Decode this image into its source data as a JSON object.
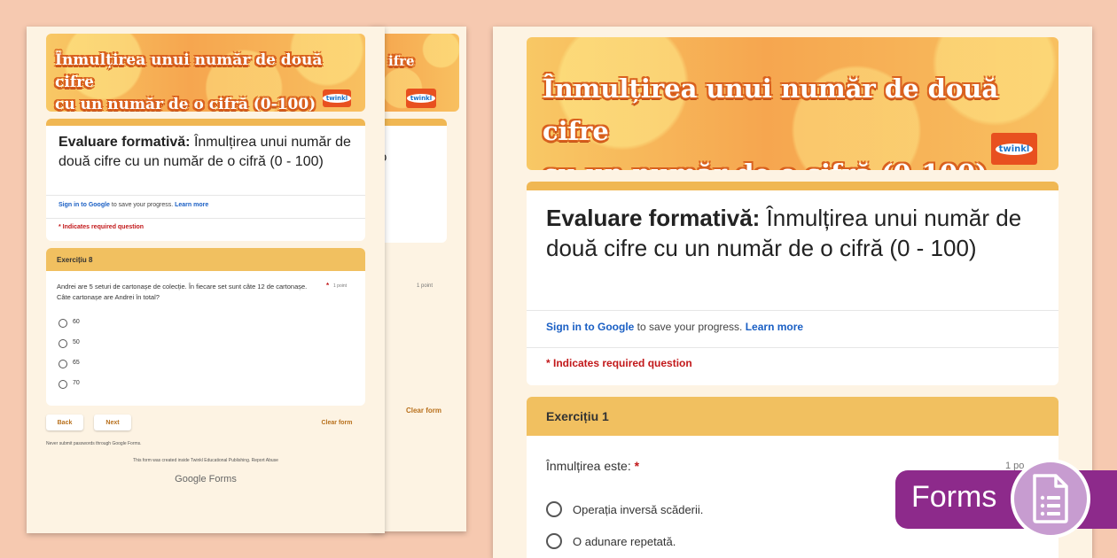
{
  "banner": {
    "line1": "Înmulțirea unui număr de două cifre",
    "line2": "cu un număr de o cifră (0-100)",
    "logo": "twinkl"
  },
  "form": {
    "title_bold": "Evaluare formativă:",
    "title_rest": " Înmulțirea unui număr de două cifre cu un număr de o cifră (0 - 100)",
    "signin_link": "Sign in to Google",
    "signin_rest": " to save your progress. ",
    "learn_more": "Learn more",
    "required_note": "* Indicates required question"
  },
  "front_sheet": {
    "section_title": "Exercițiu 1",
    "question": "Înmulțirea este:",
    "required_star": "*",
    "points": "1 po",
    "options": [
      "Operația inversă scăderii.",
      "O adunare repetată."
    ]
  },
  "back_sheet": {
    "section_title": "Exercițiu 8",
    "question": "Andrei are 5 seturi de cartonașe de colecție. În fiecare set sunt câte 12 de cartonașe. Câte cartonașe are Andrei în total?",
    "required_star": "*",
    "points": "1 point",
    "options": [
      "60",
      "50",
      "65",
      "70"
    ],
    "back_label": "Back",
    "next_label": "Next",
    "clear_label": "Clear form",
    "footer_note": "Never submit passwords through Google Forms.",
    "footer_terms": "This form was created inside Twinkl Educational Publishing. Report Abuse",
    "google_forms": "Google Forms"
  },
  "badge": {
    "label": "Forms",
    "icon": "google-forms-doc-icon"
  }
}
